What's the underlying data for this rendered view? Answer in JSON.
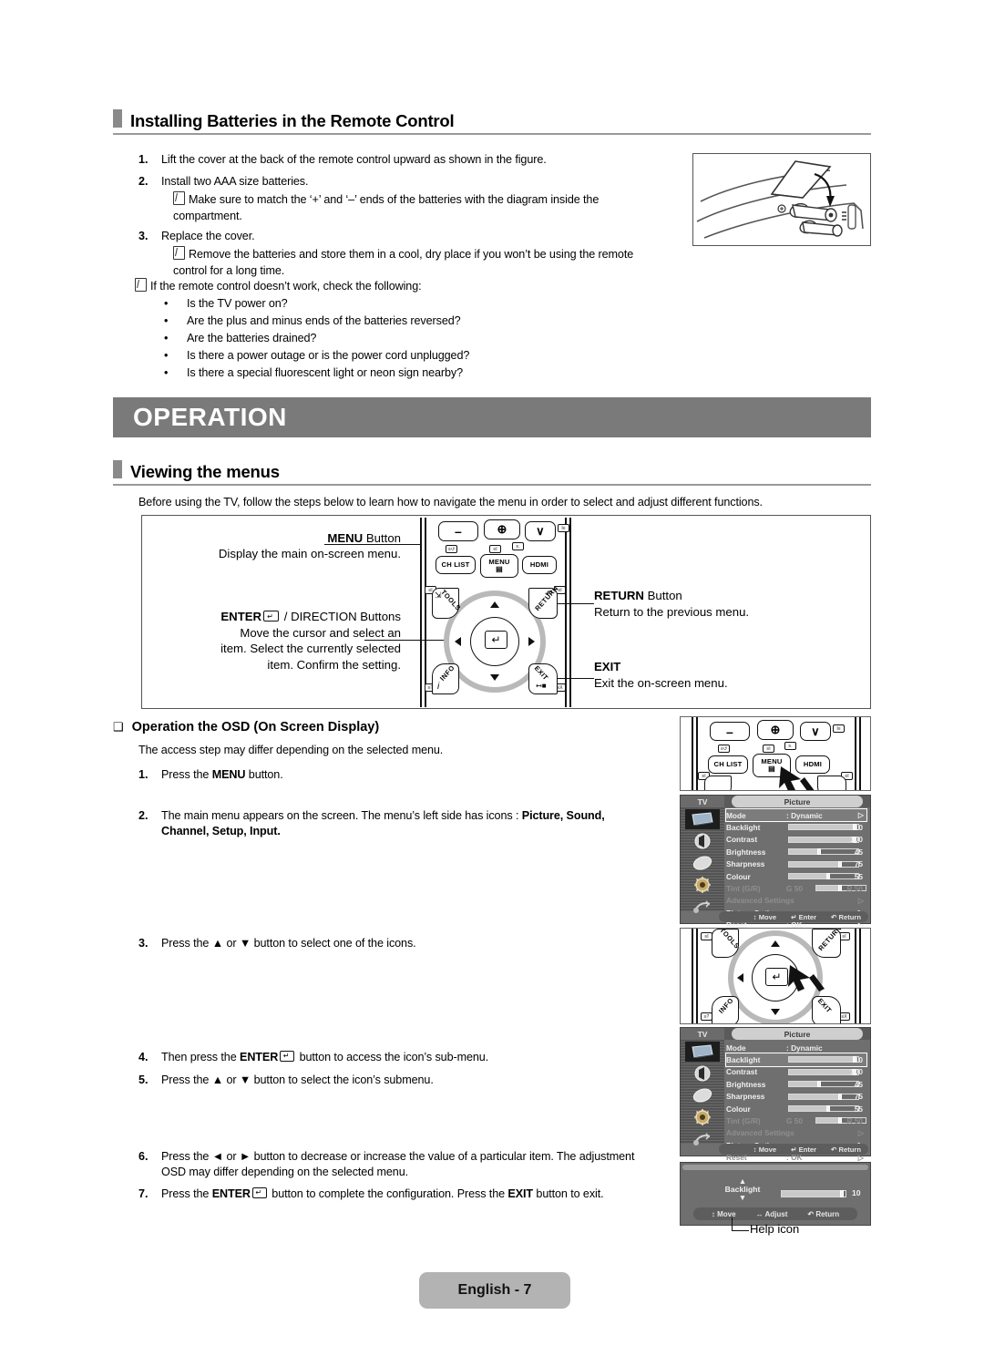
{
  "sections": {
    "batteries": {
      "title": "Installing Batteries in the Remote Control",
      "steps": [
        {
          "n": "1.",
          "text": "Lift the cover at the back of the remote control upward as shown in the figure."
        },
        {
          "n": "2.",
          "text": "Install two AAA size batteries."
        },
        {
          "n": "3.",
          "text": "Replace the cover."
        }
      ],
      "note_1": "Make sure to match the ‘+’ and ‘–’ ends of the batteries with the diagram inside the compartment.",
      "note_2": "Remove the batteries and store them in a cool, dry place if you won’t be using the remote control for a long time.",
      "note_3": "If the remote control doesn’t work, check the following:",
      "checks": [
        "Is the TV power on?",
        "Are the plus and minus ends of the batteries reversed?",
        "Are the batteries drained?",
        "Is there a power outage or is the power cord unplugged?",
        "Is there a special fluorescent light or neon sign nearby?"
      ]
    },
    "banner": {
      "label": "OPERATION"
    },
    "viewing": {
      "title": "Viewing the menus",
      "intro": "Before using the TV, follow the steps below to learn how to navigate the menu in order to select and adjust different functions.",
      "callouts": {
        "menu_title_bold": "MENU",
        "menu_title_rest": " Button",
        "menu_desc": "Display the main on-screen menu.",
        "enter_title_bold": "ENTER",
        "enter_title_rest": " / DIRECTION Buttons",
        "enter_desc_line1": "Move the cursor and select an",
        "enter_desc_line2": "item. Select the currently selected",
        "enter_desc_line3": "item. Confirm the setting.",
        "return_title_bold": "RETURN",
        "return_title_rest": " Button",
        "return_desc": "Return to the previous menu.",
        "exit_title": "EXIT",
        "exit_desc": "Exit the on-screen menu."
      }
    },
    "osd_section": {
      "title": "Operation the OSD (On Screen Display)",
      "subtitle": "The access step may differ depending on the selected menu.",
      "steps": [
        {
          "n": "1.",
          "parts": [
            "Press the ",
            "MENU",
            " button."
          ]
        },
        {
          "n": "2.",
          "line1a": "The main menu appears on the screen. The menu’s left side has icons : ",
          "line1b": "Picture, Sound,",
          "line2b": "Channel, Setup, Input."
        },
        {
          "n": "3.",
          "text": "Press the ▲ or ▼ button to select one of the icons."
        },
        {
          "n": "4.",
          "a": "Then press the ",
          "b": "ENTER",
          "c": " button to access the icon’s sub-menu."
        },
        {
          "n": "5.",
          "text": "Press the ▲ or ▼ button to select the icon’s submenu."
        },
        {
          "n": "6.",
          "line1": "Press the ◄ or ► button to decrease or increase the value of a particular item. The",
          "line2": "adjustment OSD may differ depending on the selected menu."
        },
        {
          "n": "7.",
          "a": "Press the ",
          "b": "ENTER",
          "c": " button to complete the configuration. Press the ",
          "d": "EXIT",
          "e": " button to exit."
        }
      ],
      "help_caption": "Help icon"
    }
  },
  "remote": {
    "buttons": {
      "ch_list": "CH LIST",
      "menu": "MENU",
      "hdmi": "HDMI",
      "tools": "TOOLS",
      "info": "INFO",
      "return": "RETURN",
      "exit": "EXIT",
      "minus": "–",
      "source": "⊕",
      "chevron": "∨"
    },
    "chips": {
      "ch_list": "≡↺",
      "menu": "≡I",
      "source": "≡.",
      "chevron": "I≡",
      "tools": "≡I",
      "return": "≡I",
      "info": "≡?",
      "exit": "≡X"
    }
  },
  "osd": {
    "tv_label": "TV",
    "title": "Picture",
    "rows": [
      {
        "label": "Mode",
        "value": ": Dynamic",
        "type": "arrow"
      },
      {
        "label": "Backlight",
        "type": "slider",
        "percent": 96,
        "num": "10"
      },
      {
        "label": "Contrast",
        "type": "slider",
        "percent": 96,
        "num": "100"
      },
      {
        "label": "Brightness",
        "type": "slider",
        "percent": 44,
        "num": "45"
      },
      {
        "label": "Sharpness",
        "type": "slider",
        "percent": 74,
        "num": "75"
      },
      {
        "label": "Colour",
        "type": "slider",
        "percent": 56,
        "num": "55"
      },
      {
        "label": "Tint (G/R)",
        "value": "G  50",
        "type": "tint",
        "num": "R  50"
      },
      {
        "label": "Advanced Settings",
        "type": "arrow"
      },
      {
        "label": "Picture Options",
        "type": "arrow"
      },
      {
        "label": "Reset",
        "value": ": OK",
        "type": "arrow"
      }
    ],
    "hints": {
      "move": "Move",
      "enter": "Enter",
      "return": "Return",
      "adjust": "Adjust"
    },
    "adjust": {
      "label": "Backlight",
      "num": "10",
      "percent": 96
    }
  },
  "footer": {
    "label": "English - 7"
  }
}
